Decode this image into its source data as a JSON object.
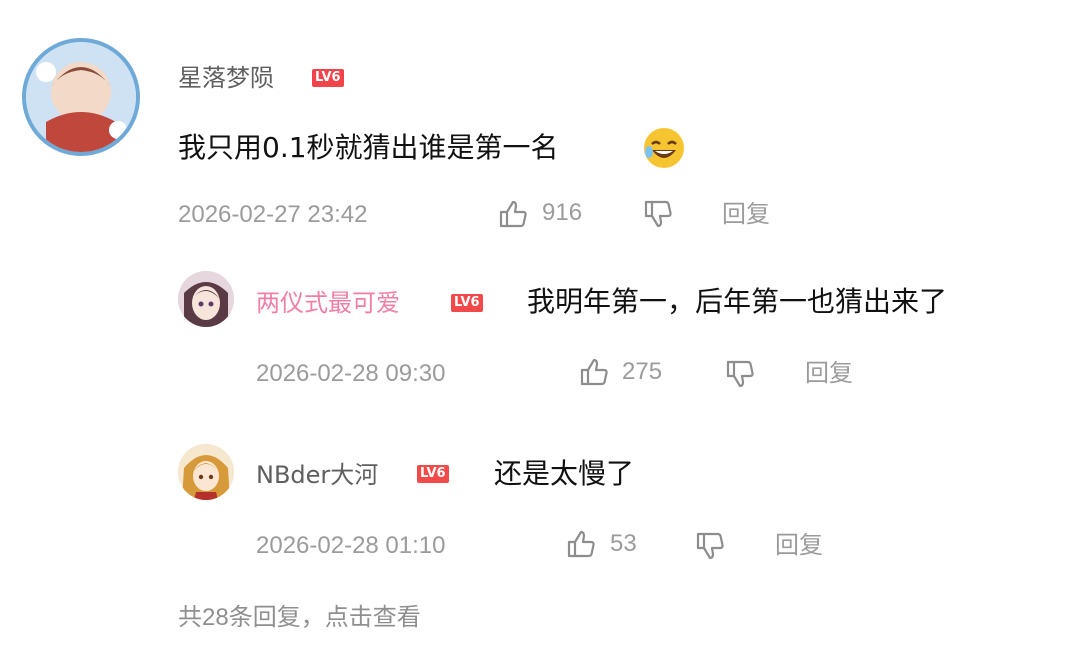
{
  "comment": {
    "username": "星落梦陨",
    "level": "LV6",
    "text": "我只用0.1秒就猜出谁是第一名",
    "timestamp": "2026-02-27 23:42",
    "likes": "916",
    "reply_label": "回复"
  },
  "replies": [
    {
      "username": "两仪式最可爱",
      "level": "LV6",
      "text": "我明年第一，后年第一也猜出来了",
      "timestamp": "2026-02-28 09:30",
      "likes": "275",
      "reply_label": "回复"
    },
    {
      "username": "NBder大河",
      "level": "LV6",
      "text": "还是太慢了",
      "timestamp": "2026-02-28 01:10",
      "likes": "53",
      "reply_label": "回复"
    }
  ],
  "footer": {
    "view_replies": "共28条回复，点击查看"
  },
  "colors": {
    "level_badge": "#f24a4a",
    "pink_username": "#f07fa6",
    "meta_gray": "#9b9b9b"
  }
}
